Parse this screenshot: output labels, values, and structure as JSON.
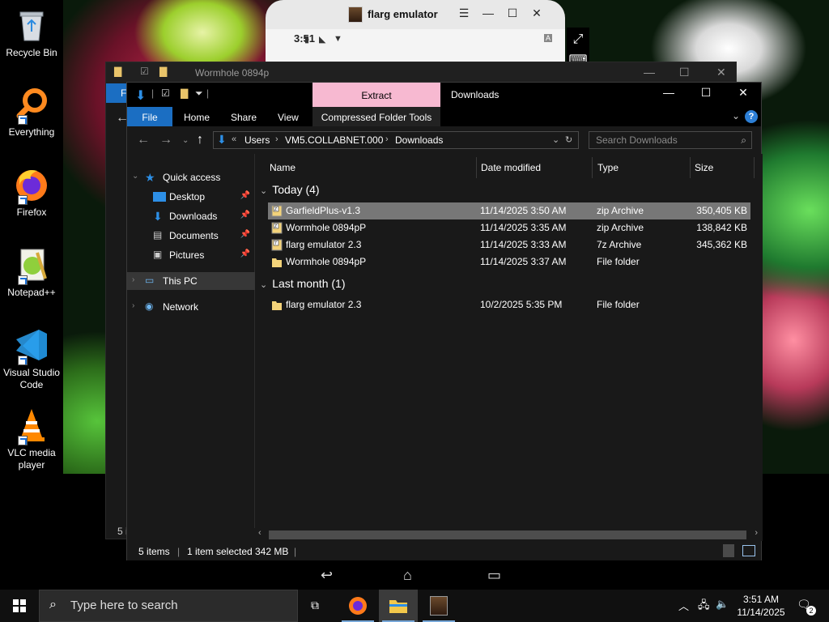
{
  "desktop": {
    "icons": [
      {
        "label": "Recycle Bin",
        "icon": "recycle-bin-icon"
      },
      {
        "label": "Everything",
        "icon": "everything-icon"
      },
      {
        "label": "Firefox",
        "icon": "firefox-icon"
      },
      {
        "label": "Notepad++",
        "icon": "notepad-plus-plus-icon"
      },
      {
        "label": "Visual Studio Code",
        "icon": "vscode-icon"
      },
      {
        "label": "VLC media player",
        "icon": "vlc-icon"
      }
    ]
  },
  "emulator": {
    "title": "flarg emulator",
    "status_time": "3:51"
  },
  "background_explorer": {
    "title": "Wormhole 0894p",
    "file_tab": "F",
    "status_partial": "5 i"
  },
  "explorer": {
    "context_tab_label": "Extract",
    "window_title": "Downloads",
    "ribbon_tabs": {
      "file": "File",
      "home": "Home",
      "share": "Share",
      "view": "View",
      "compressed": "Compressed Folder Tools"
    },
    "address": {
      "overflow": "«",
      "crumbs": [
        "Users",
        "VM5.COLLABNET.000",
        "Downloads"
      ]
    },
    "search_placeholder": "Search Downloads",
    "nav": {
      "quick_access": "Quick access",
      "desktop": "Desktop",
      "downloads": "Downloads",
      "documents": "Documents",
      "pictures": "Pictures",
      "this_pc": "This PC",
      "network": "Network"
    },
    "columns": {
      "name": "Name",
      "date": "Date modified",
      "type": "Type",
      "size": "Size"
    },
    "groups": {
      "today": "Today (4)",
      "last_month": "Last month (1)"
    },
    "files_today": [
      {
        "name": "GarfieldPlus-v1.3",
        "date": "11/14/2025 3:50 AM",
        "type": "zip Archive",
        "size": "350,405 KB",
        "icon": "zip-archive-icon"
      },
      {
        "name": "Wormhole 0894pP",
        "date": "11/14/2025 3:35 AM",
        "type": "zip Archive",
        "size": "138,842 KB",
        "icon": "zip-archive-icon"
      },
      {
        "name": "flarg emulator 2.3",
        "date": "11/14/2025 3:33 AM",
        "type": "7z Archive",
        "size": "345,362 KB",
        "icon": "7z-archive-icon"
      },
      {
        "name": "Wormhole 0894pP",
        "date": "11/14/2025 3:37 AM",
        "type": "File folder",
        "size": "",
        "icon": "folder-icon"
      }
    ],
    "files_last_month": [
      {
        "name": "flarg emulator 2.3",
        "date": "10/2/2025 5:35 PM",
        "type": "File folder",
        "size": "",
        "icon": "folder-icon"
      }
    ],
    "status": {
      "items": "5 items",
      "selected": "1 item selected",
      "size": "342 MB"
    }
  },
  "taskbar": {
    "search_placeholder": "Type here to search",
    "time": "3:51 AM",
    "date": "11/14/2025",
    "notification_count": "2"
  },
  "colors": {
    "accent": "#1b6ec2",
    "context_tab": "#f7b9d1",
    "selection": "#777777"
  }
}
